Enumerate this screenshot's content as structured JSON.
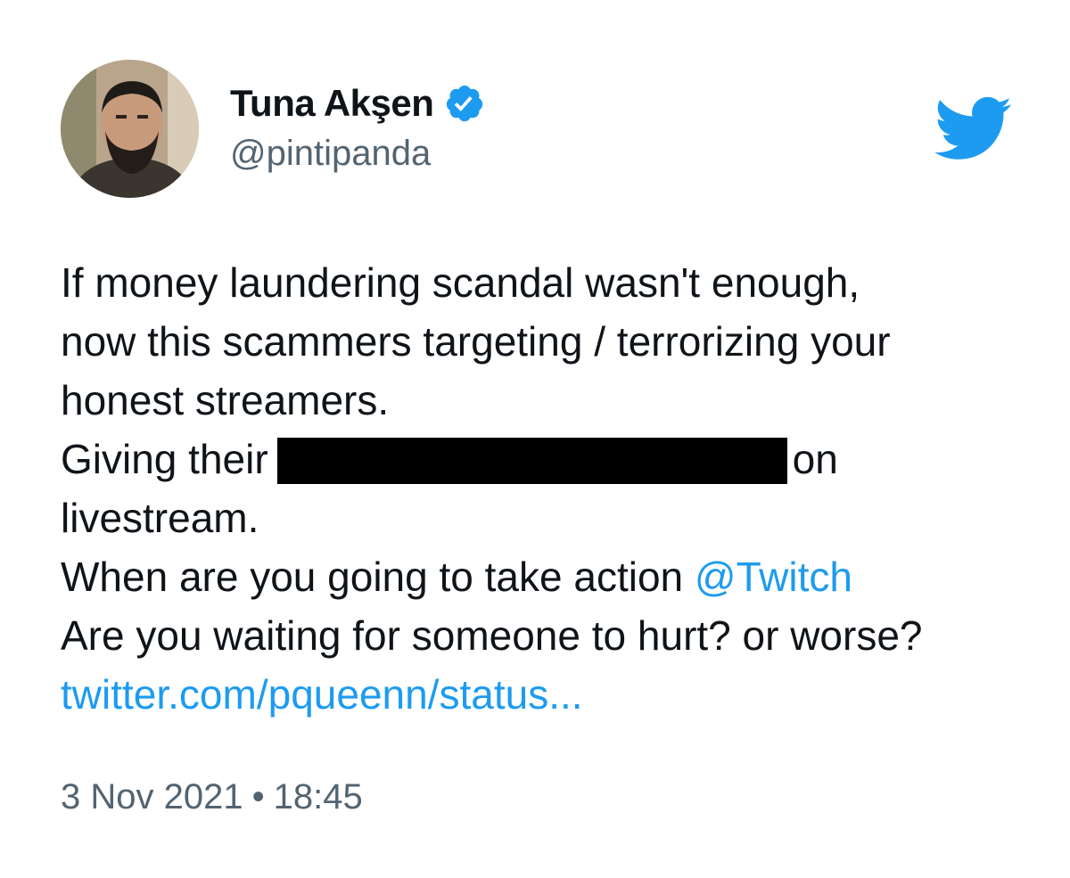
{
  "author": {
    "name": "Tuna Akşen",
    "handle": "@pintipanda",
    "verified": true
  },
  "icons": {
    "avatar": "avatar",
    "verified": "verified-badge-icon",
    "brand": "twitter-bird-icon"
  },
  "colors": {
    "link": "#1d9bf0",
    "secondary_text": "#536471",
    "brand": "#1d9bf0"
  },
  "tweet": {
    "line1": "If money laundering scandal wasn't enough,",
    "line2": "now this scammers targeting / terrorizing your",
    "line3": "honest streamers.",
    "line4_before": "Giving their",
    "line4_after": "on",
    "line5": "livestream.",
    "line6_before": "When are you going to take action ",
    "line6_mention": "@Twitch",
    "line7": "Are you waiting for someone to hurt? or worse?",
    "link": "twitter.com/pqueenn/status..."
  },
  "timestamp": {
    "date": "3 Nov 2021",
    "separator": "•",
    "time": "18:45"
  }
}
